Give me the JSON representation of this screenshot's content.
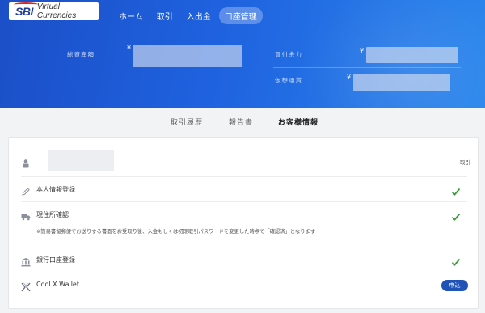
{
  "header": {
    "logo_mark": "SBI",
    "logo_text": "Virtual Currencies",
    "nav": [
      "ホーム",
      "取引",
      "入出金",
      "口座管理"
    ],
    "active_nav": "口座管理"
  },
  "summary": {
    "total_assets_label": "総資産額",
    "buying_power_label": "買付余力",
    "virtual_currency_label": "仮想通貨",
    "currency_symbol": "¥"
  },
  "tabs": {
    "items": [
      "取引履歴",
      "報告書",
      "お客様情報"
    ],
    "active": "お客様情報"
  },
  "customer": {
    "trade_link": "取引",
    "rows": {
      "identity": {
        "label": "本人情報登録",
        "status": "done"
      },
      "address": {
        "label": "現住所確認",
        "status": "done",
        "note": "※簡易書留郵便でお送りする書面をお受取り後、入金もしくは初期取引パスワードを変更した時点で「確認済」となります"
      },
      "bank": {
        "label": "銀行口座登録",
        "status": "done"
      },
      "wallet": {
        "label": "Cool X Wallet",
        "button": "申込"
      }
    }
  },
  "colors": {
    "primary": "#1f54b6",
    "check": "#3a9b3a",
    "hero_gradient_start": "#1b4fc7",
    "hero_gradient_end": "#2a86ec"
  }
}
